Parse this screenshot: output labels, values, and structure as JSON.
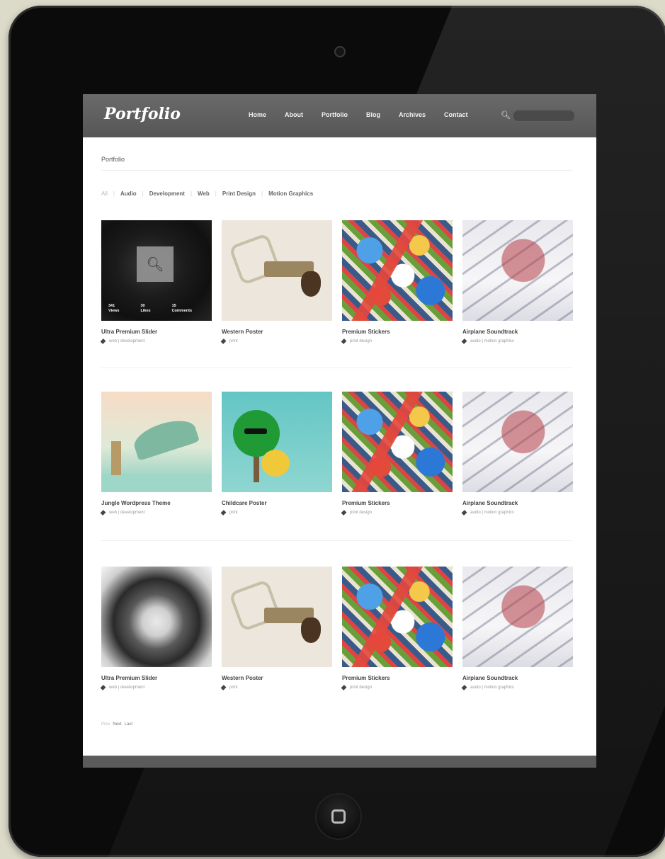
{
  "site": {
    "logo": "Portfolio",
    "nav": [
      "Home",
      "About",
      "Portfolio",
      "Blog",
      "Archives",
      "Contact"
    ],
    "search_icon": "search-icon",
    "search_placeholder": ""
  },
  "page": {
    "breadcrumb": "Portfolio",
    "filters": [
      "All",
      "Audio",
      "Development",
      "Web",
      "Print Design",
      "Motion Graphics"
    ],
    "active_filter": "All"
  },
  "hover": {
    "views_count": "341",
    "views_label": "Views",
    "likes_count": "30",
    "likes_label": "Likes",
    "comments_count": "15",
    "comments_label": "Comments"
  },
  "items": [
    {
      "title": "Ultra Premium Slider",
      "category": "web | development",
      "thumb": "portrait-dark"
    },
    {
      "title": "Western Poster",
      "category": "print",
      "thumb": "poster"
    },
    {
      "title": "Premium Stickers",
      "category": "print design",
      "thumb": "stickers"
    },
    {
      "title": "Airplane Soundtrack",
      "category": "audio | motion graphics",
      "thumb": "plane"
    },
    {
      "title": "Jungle Wordpress Theme",
      "category": "web | development",
      "thumb": "jungle"
    },
    {
      "title": "Childcare Poster",
      "category": "print",
      "thumb": "childcare"
    },
    {
      "title": "Premium Stickers",
      "category": "print design",
      "thumb": "stickers"
    },
    {
      "title": "Airplane Soundtrack",
      "category": "audio | motion graphics",
      "thumb": "plane"
    },
    {
      "title": "Ultra Premium Slider",
      "category": "web | development",
      "thumb": "portrait"
    },
    {
      "title": "Western Poster",
      "category": "print",
      "thumb": "poster"
    },
    {
      "title": "Premium Stickers",
      "category": "print design",
      "thumb": "stickers"
    },
    {
      "title": "Airplane Soundtrack",
      "category": "audio | motion graphics",
      "thumb": "plane"
    }
  ],
  "pagination": {
    "current": "Prev",
    "links": [
      "Next",
      "Last"
    ]
  }
}
